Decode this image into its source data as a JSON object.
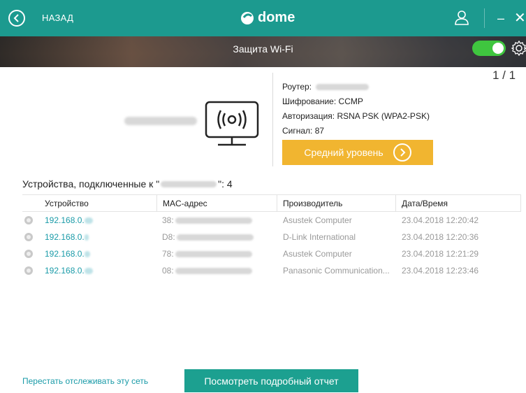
{
  "header": {
    "back_label": "НАЗАД",
    "logo_text": "dome",
    "minimize_glyph": "–",
    "close_glyph": "✕",
    "section_title": "Защита Wi-Fi",
    "toggle_on": true
  },
  "pager": "1 / 1",
  "router_info": {
    "router_label": "Роутер:",
    "encryption_label": "Шифрование:",
    "encryption_value": "CCMP",
    "auth_label": "Авторизация:",
    "auth_value": "RSNA PSK (WPA2-PSK)",
    "signal_label": "Сигнал:",
    "signal_value": "87"
  },
  "level_button": "Средний уровень",
  "devices": {
    "title_prefix": "Устройства, подключенные к \"",
    "title_suffix": "\": 4",
    "columns": [
      "Устройство",
      "MAC-адрес",
      "Производитель",
      "Дата/Время"
    ],
    "rows": [
      {
        "ip": "192.168.0.",
        "mac": "38:",
        "vendor": "Asustek Computer",
        "datetime": "23.04.2018 12:20:42"
      },
      {
        "ip": "192.168.0.",
        "mac": "D8:",
        "vendor": "D-Link International",
        "datetime": "23.04.2018 12:20:36"
      },
      {
        "ip": "192.168.0.",
        "mac": "78:",
        "vendor": "Asustek Computer",
        "datetime": "23.04.2018 12:21:29"
      },
      {
        "ip": "192.168.0.",
        "mac": "08:",
        "vendor": "Panasonic Communication...",
        "datetime": "23.04.2018 12:23:46"
      }
    ]
  },
  "footer": {
    "stop_link": "Перестать отслеживать эту сеть",
    "report_button": "Посмотреть подробный отчет"
  },
  "colors": {
    "accent_teal": "#1ca090",
    "link_teal": "#1a9ba8",
    "warning_yellow": "#f1b530",
    "toggle_green": "#3fc63f"
  }
}
